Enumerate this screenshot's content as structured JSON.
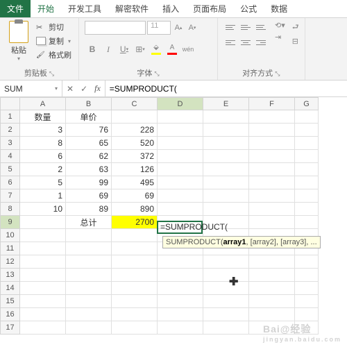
{
  "tabs": {
    "file": "文件",
    "items": [
      "开始",
      "开发工具",
      "解密软件",
      "插入",
      "页面布局",
      "公式",
      "数据"
    ]
  },
  "ribbon": {
    "paste_label": "粘贴",
    "cut": "剪切",
    "copy": "复制",
    "format_painter": "格式刷",
    "clipboard_group": "剪贴板",
    "font_group": "字体",
    "align_group": "对齐方式",
    "font_size": "11",
    "btns": {
      "B": "B",
      "I": "I",
      "U": "U",
      "wen": "wén"
    }
  },
  "formula_bar": {
    "namebox": "SUM",
    "cancel": "✕",
    "accept": "✓",
    "fx": "fx",
    "formula": "=SUMPRODUCT("
  },
  "columns": [
    "A",
    "B",
    "C",
    "D",
    "E",
    "F",
    "G"
  ],
  "rows": [
    {
      "n": 1,
      "A": "数量",
      "B": "单价",
      "C": "",
      "D": ""
    },
    {
      "n": 2,
      "A": "3",
      "B": "76",
      "C": "228",
      "D": ""
    },
    {
      "n": 3,
      "A": "8",
      "B": "65",
      "C": "520",
      "D": ""
    },
    {
      "n": 4,
      "A": "6",
      "B": "62",
      "C": "372",
      "D": ""
    },
    {
      "n": 5,
      "A": "2",
      "B": "63",
      "C": "126",
      "D": ""
    },
    {
      "n": 6,
      "A": "5",
      "B": "99",
      "C": "495",
      "D": ""
    },
    {
      "n": 7,
      "A": "1",
      "B": "69",
      "C": "69",
      "D": ""
    },
    {
      "n": 8,
      "A": "10",
      "B": "89",
      "C": "890",
      "D": ""
    },
    {
      "n": 9,
      "A": "",
      "B": "总计",
      "C": "2700",
      "D": "=SUMPRODUCT("
    }
  ],
  "blank_rows": [
    "10",
    "11",
    "12",
    "13",
    "14",
    "15",
    "16",
    "17"
  ],
  "tooltip": {
    "fn": "SUMPRODUCT(",
    "a1": "array1",
    "rest": ", [array2], [array3], ..."
  },
  "active": {
    "col": "D",
    "row": 9
  },
  "watermark": {
    "main": "Bai@经验",
    "sub": "jingyan.baidu.com"
  }
}
